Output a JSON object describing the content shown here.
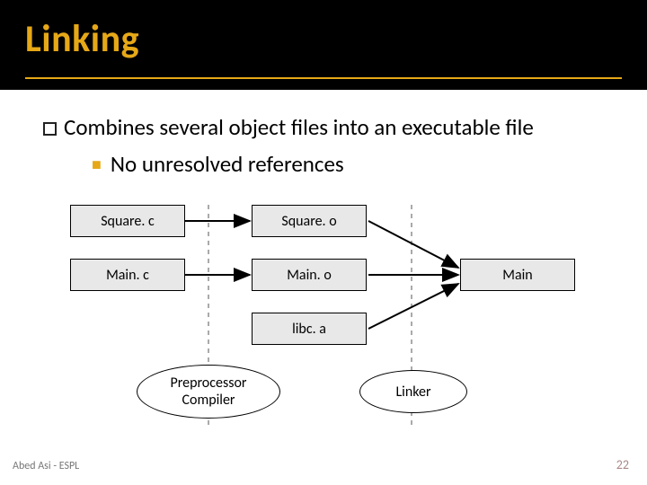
{
  "title": "Linking",
  "bullets": {
    "main": "Combines several object files into an executable file",
    "sub": "No unresolved references"
  },
  "diagram": {
    "boxes": {
      "src1": "Square. c",
      "src2": "Main. c",
      "obj1": "Square. o",
      "obj2": "Main. o",
      "lib": "libc. a",
      "exe": "Main"
    },
    "stages": {
      "compile": "Preprocessor\nCompiler",
      "link": "Linker"
    }
  },
  "footer": {
    "left": "Abed Asi - ESPL",
    "right": "22"
  }
}
